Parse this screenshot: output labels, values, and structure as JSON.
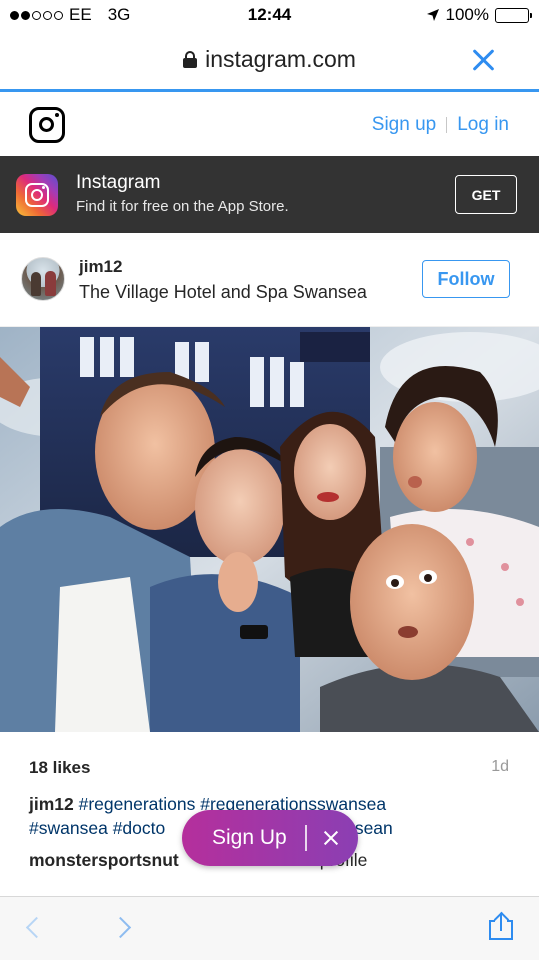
{
  "status_bar": {
    "carrier": "EE",
    "network": "3G",
    "time": "12:44",
    "battery": "100%",
    "signal_bars_on": 2,
    "signal_bars_total": 5
  },
  "browser": {
    "url": "instagram.com",
    "accent_color": "#2e8cf0"
  },
  "ig_header": {
    "sign_up": "Sign up",
    "log_in": "Log in"
  },
  "app_banner": {
    "title": "Instagram",
    "subtitle": "Find it for free on the App Store.",
    "get_label": "GET"
  },
  "post": {
    "username": "jim12",
    "location": "The Village Hotel and Spa Swansea",
    "follow_label": "Follow",
    "likes": "18 likes",
    "age": "1d",
    "caption_user": "jim12",
    "caption_tags_line1": [
      "#regenerations",
      "#regenerationsswansea"
    ],
    "caption_tag_line2_a": "#swansea",
    "caption_tag_line2_b": "#docto",
    "caption_tag_line2_c": "otsean",
    "comment_user": "monstersportsnut",
    "comment_text": "profile"
  },
  "signup_pill": {
    "label": "Sign Up",
    "color_start": "#b52f9c",
    "color_end": "#8b3fb3"
  }
}
